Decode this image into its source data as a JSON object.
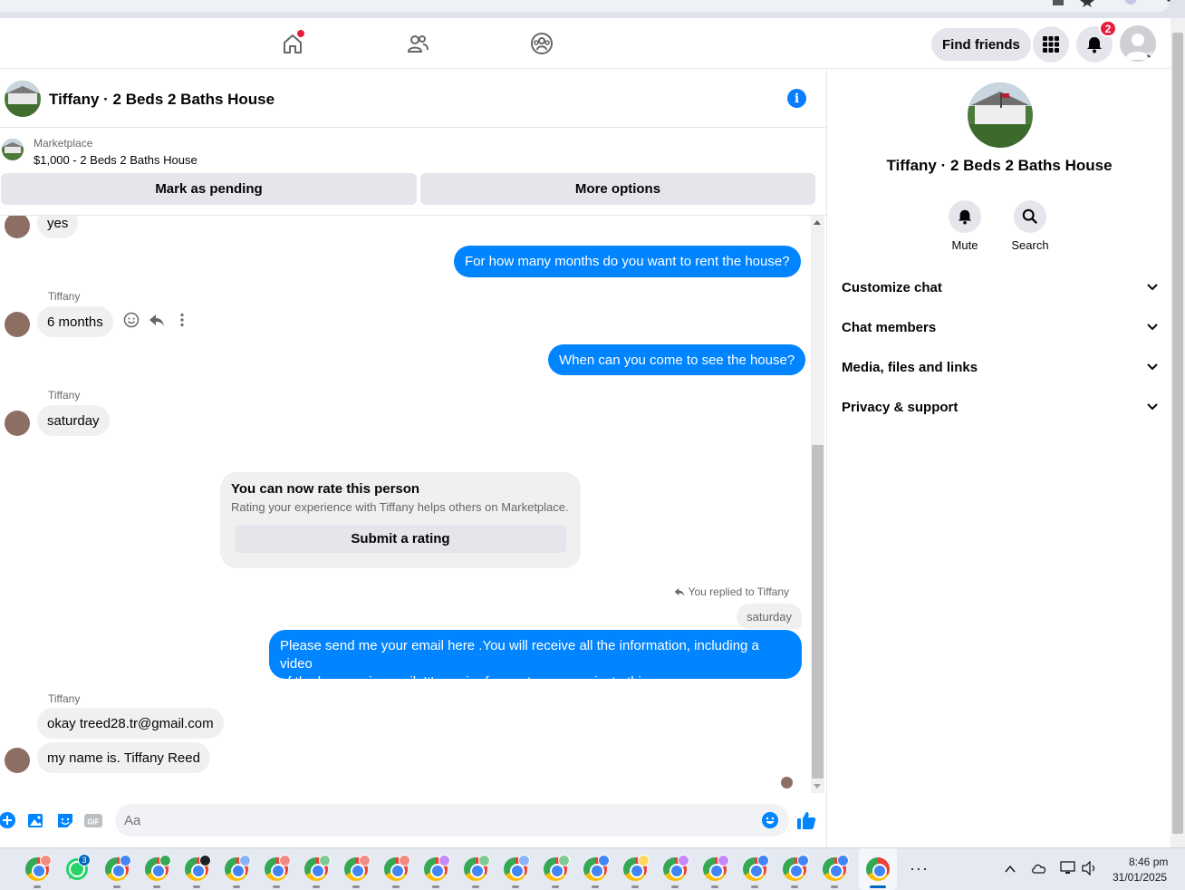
{
  "colors": {
    "accent": "#0084ff",
    "notification_red": "#e41e3f",
    "bubble_incoming": "#f0f0f0",
    "button_gray": "#e4e6eb"
  },
  "topnav": {
    "icons": [
      "home-icon",
      "friends-icon",
      "groups-icon"
    ],
    "find_friends": "Find friends",
    "notification_count": "2"
  },
  "chat": {
    "title": "Tiffany · 2 Beds 2 Baths House",
    "marketplace_label": "Marketplace",
    "listing": "$1,000 - 2 Beds 2 Baths House",
    "mark_pending": "Mark as pending",
    "more_options": "More options"
  },
  "messages": {
    "m1": "yes",
    "m2": "For how many months do you want to rent the house?",
    "sender1": "Tiffany",
    "m3": "6 months",
    "m4": "When can you come to see the house?",
    "sender2": "Tiffany",
    "m5": "saturday",
    "rate_title": "You can now rate this person",
    "rate_sub": "Rating your experience with Tiffany helps others on Marketplace.",
    "rate_button": "Submit a rating",
    "replied_note": "You replied to Tiffany",
    "quoted": "saturday",
    "m6_line1": "Please send me your email here .You will receive all the information, including a video",
    "m6_line2": "of the house, via email. It's easier for me to communicate this way",
    "sender3": "Tiffany",
    "m7": "okay treed28.tr@gmail.com",
    "m8": "my name is. Tiffany Reed"
  },
  "composer": {
    "placeholder": "Aa"
  },
  "right_panel": {
    "title": "Tiffany · 2 Beds 2 Baths House",
    "mute": "Mute",
    "search": "Search",
    "sections": [
      "Customize chat",
      "Chat members",
      "Media, files and links",
      "Privacy & support"
    ]
  },
  "taskbar": {
    "time": "8:46 pm",
    "date": "31/01/2025",
    "whatsapp_badge": "3",
    "more": "···"
  }
}
